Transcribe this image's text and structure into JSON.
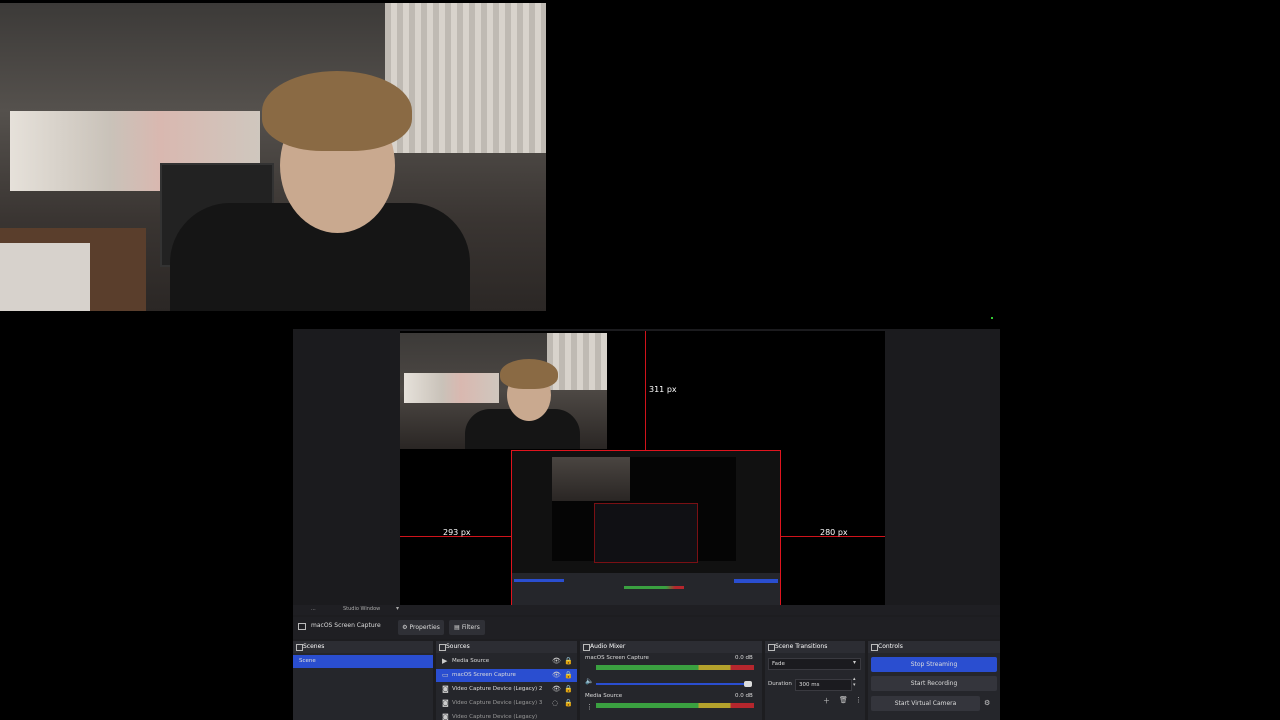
{
  "preview": {
    "dimension_top": "311 px",
    "dimension_left": "293 px",
    "dimension_right": "280 px"
  },
  "toolbar": {
    "scene_label": "...",
    "mode_label": "Studio Window"
  },
  "source_bar": {
    "selected_source": "macOS Screen Capture",
    "properties_label": "Properties",
    "filters_label": "Filters"
  },
  "docks": {
    "scenes": {
      "title": "Scenes",
      "items": [
        "Scene"
      ]
    },
    "sources": {
      "title": "Sources",
      "items": [
        {
          "label": "Media Source",
          "icon": "play-icon",
          "selected": false
        },
        {
          "label": "macOS Screen Capture",
          "icon": "monitor-icon",
          "selected": true
        },
        {
          "label": "Video Capture Device (Legacy) 2",
          "icon": "camera-icon",
          "selected": false
        },
        {
          "label": "Video Capture Device (Legacy) 3",
          "icon": "camera-icon",
          "selected": false
        },
        {
          "label": "Video Capture Device (Legacy)",
          "icon": "camera-icon",
          "selected": false
        }
      ]
    },
    "audio_mixer": {
      "title": "Audio Mixer",
      "channels": [
        {
          "name": "macOS Screen Capture",
          "db": "0.0 dB"
        },
        {
          "name": "Media Source",
          "db": "0.0 dB"
        }
      ]
    },
    "scene_transitions": {
      "title": "Scene Transitions",
      "transition": "Fade",
      "duration_label": "Duration",
      "duration_value": "300 ms"
    },
    "controls": {
      "title": "Controls",
      "buttons": [
        "Stop Streaming",
        "Start Recording",
        "Start Virtual Camera"
      ]
    }
  },
  "colors": {
    "accent": "#2a4ed0",
    "guide": "#d0131b"
  }
}
